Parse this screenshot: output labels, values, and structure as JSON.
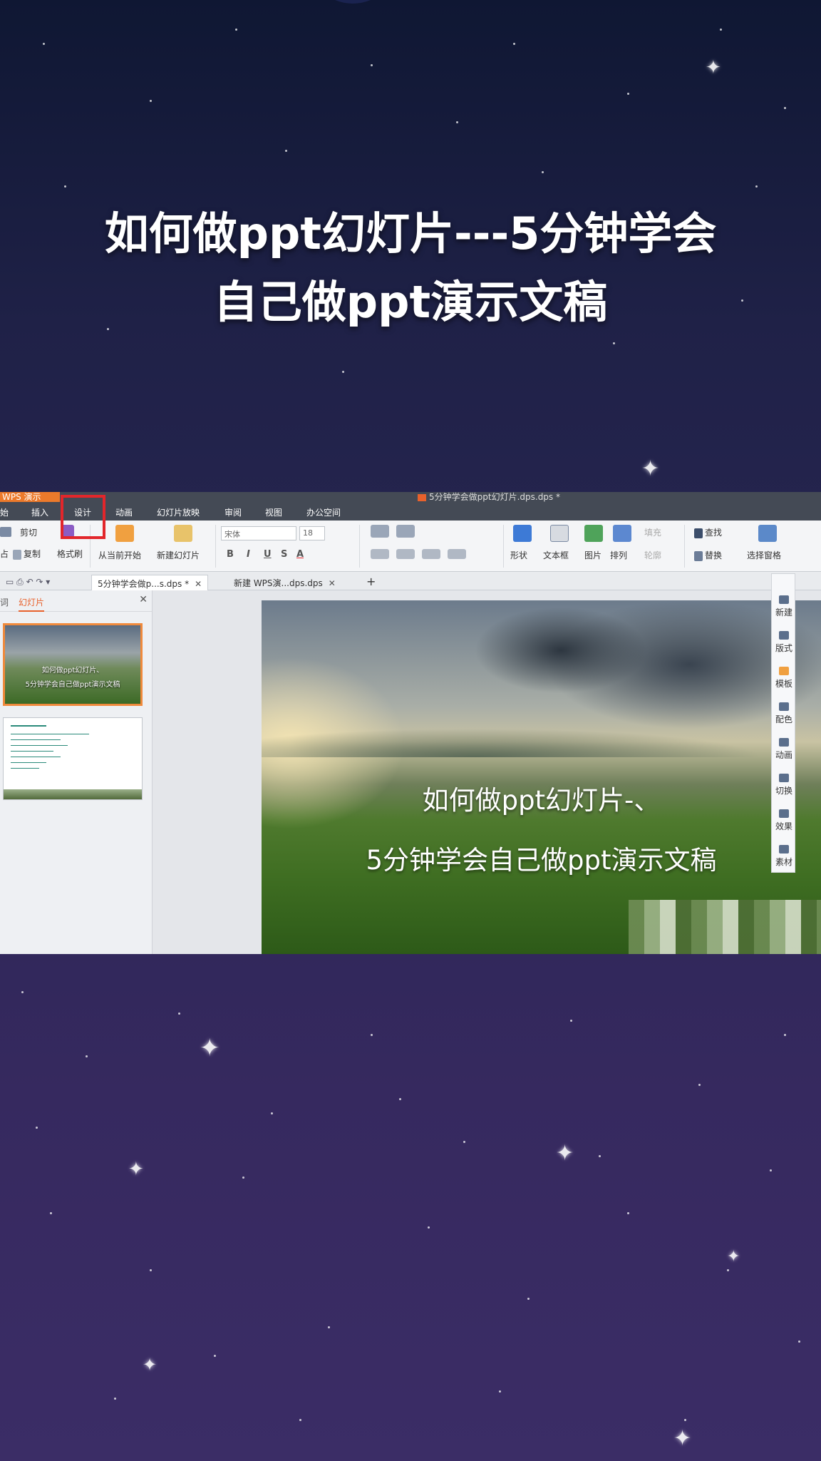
{
  "headline": {
    "line1": "如何做ppt幻灯片---5分钟学会",
    "line2": "自己做ppt演示文稿"
  },
  "app": {
    "brand": "WPS 演示",
    "window_title": "5分钟学会做ppt幻灯片.dps.dps *",
    "menu": [
      "始",
      "插入",
      "设计",
      "动画",
      "幻灯片放映",
      "审阅",
      "视图",
      "办公空间"
    ],
    "ribbon": {
      "cut": "剪切",
      "paste_partial": "占",
      "copy": "复制",
      "format_painter": "格式刷",
      "from_current": "从当前开始",
      "new_slide": "新建幻灯片",
      "font_name": "宋体",
      "font_size": "18",
      "bold": "B",
      "italic": "I",
      "underline": "U",
      "strike": "S",
      "fontcolor": "A",
      "shape": "形状",
      "textbox": "文本框",
      "picture": "图片",
      "arrange": "排列",
      "fill": "填充",
      "outline": "轮廓",
      "find": "查找",
      "replace": "替换",
      "selection_pane": "选择窗格"
    },
    "doc_tabs": [
      {
        "label": "5分钟学会做p...s.dps *"
      },
      {
        "label": "新建 WPS演...dps.dps"
      }
    ],
    "panel": {
      "tab_outline": "词",
      "tab_slides": "幻灯片"
    },
    "thumb1_caption": [
      "如何做ppt幻灯片、",
      "5分钟学会自己做ppt演示文稿"
    ],
    "slide_text": {
      "line1": "如何做ppt幻灯片-、",
      "line2": "5分钟学会自己做ppt演示文稿"
    },
    "side_tools": [
      "新建",
      "版式",
      "模板",
      "配色",
      "动画",
      "切换",
      "效果",
      "素材"
    ]
  },
  "colors": {
    "accent": "#e8612c",
    "highlight": "#e2262b",
    "titlebar": "#444a55"
  }
}
